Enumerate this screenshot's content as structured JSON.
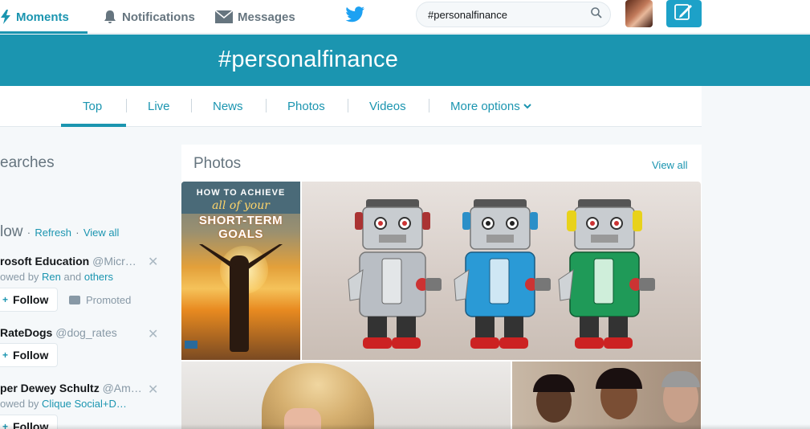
{
  "topnav": {
    "moments_label": "Moments",
    "notifications_label": "Notifications",
    "messages_label": "Messages",
    "search_value": "#personalfinance",
    "accent_color": "#1b95b0"
  },
  "banner": {
    "title": "#personalfinance"
  },
  "tabs": [
    {
      "label": "Top",
      "active": true
    },
    {
      "label": "Live"
    },
    {
      "label": "News"
    },
    {
      "label": "Photos"
    },
    {
      "label": "Videos"
    },
    {
      "label": "More options"
    }
  ],
  "sidebar": {
    "searches_heading": "earches",
    "who_to_follow": {
      "heading": "low",
      "refresh_label": "Refresh",
      "view_all_label": "View all",
      "separator": "·",
      "users": [
        {
          "name": "rosoft Education",
          "handle": "@Micr…",
          "followed_by_prefix": "owed by",
          "followed_by_1": "Ren",
          "followed_by_and": "and",
          "followed_by_2": "others",
          "follow_label": "Follow",
          "promoted_label": "Promoted"
        },
        {
          "name": "RateDogs",
          "handle": "@dog_rates",
          "follow_label": "Follow"
        },
        {
          "name": "per Dewey Schultz",
          "handle": "@Am…",
          "followed_by_prefix": "owed by",
          "followed_by_1": "Clique Social+D…",
          "follow_label": "Follow"
        }
      ]
    }
  },
  "photos": {
    "heading": "Photos",
    "view_all_label": "View all",
    "tile1": {
      "line1": "HOW TO ACHIEVE",
      "line2": "all of your",
      "line3": "SHORT-TERM GOALS"
    }
  }
}
